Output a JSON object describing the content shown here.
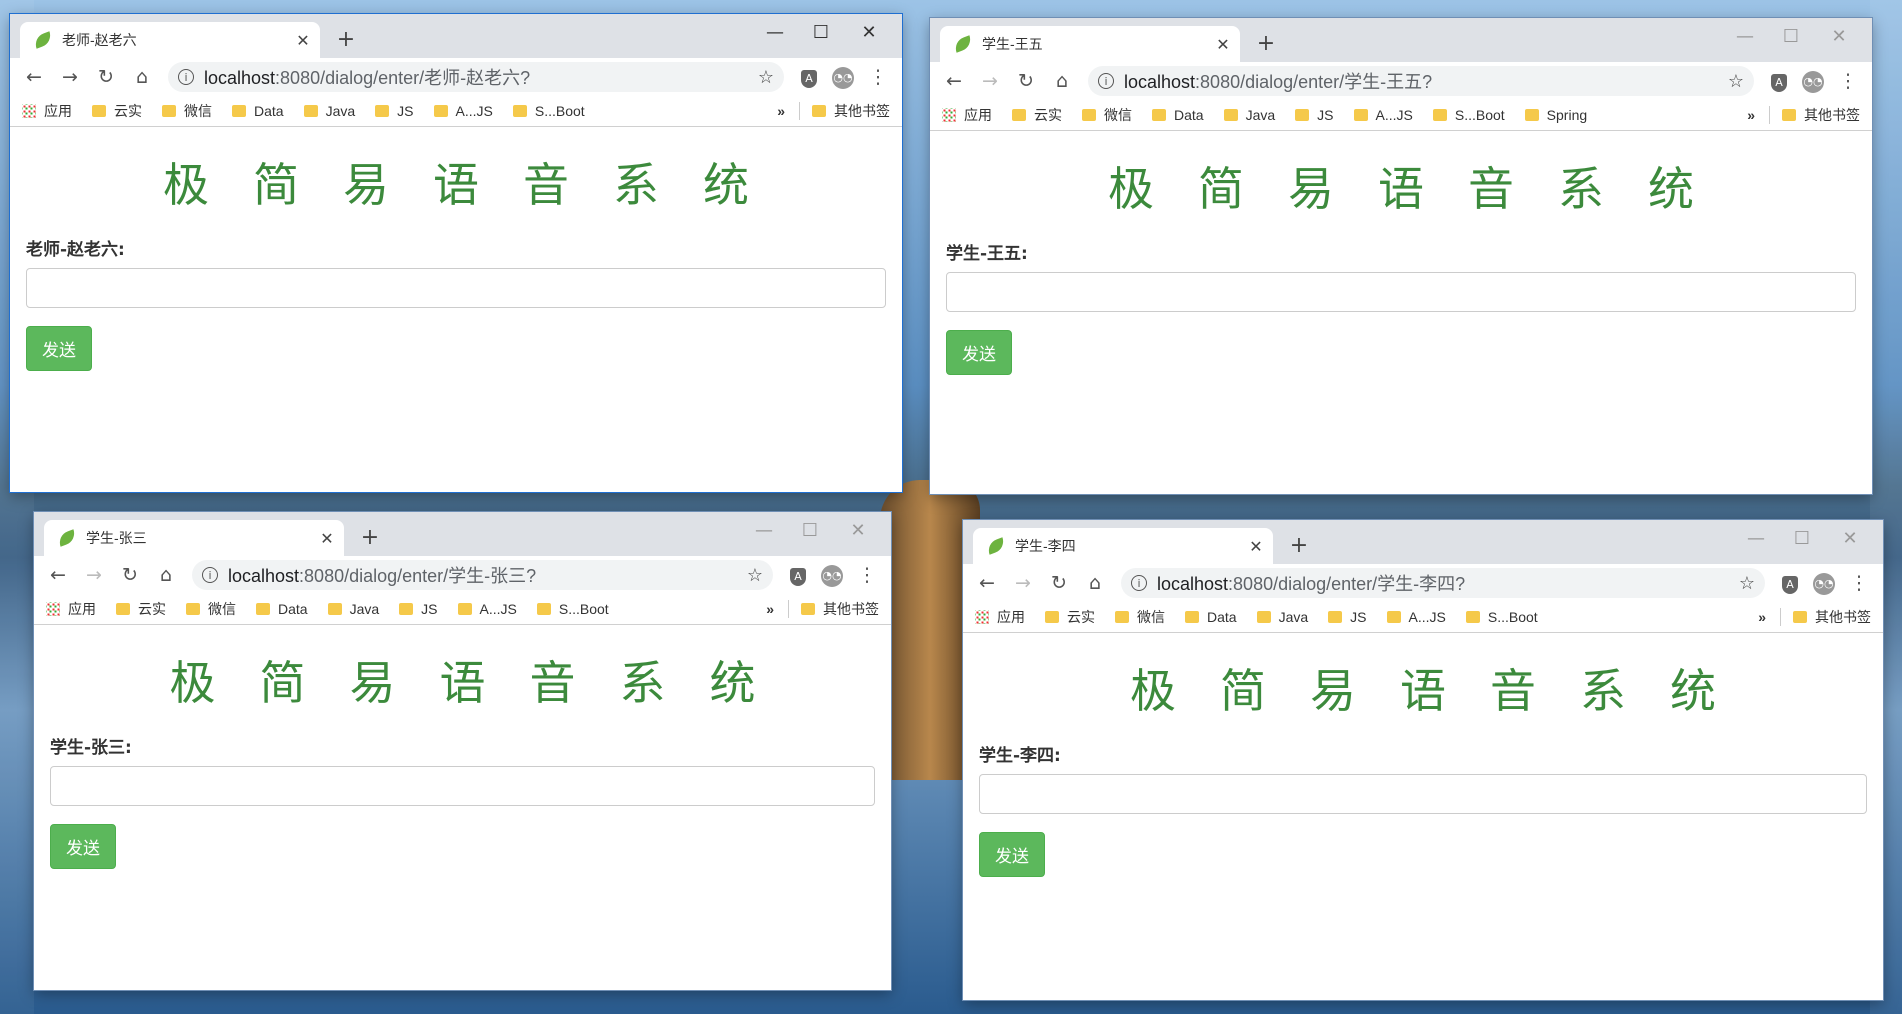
{
  "title": "极简易语音系统",
  "heading_chars": [
    "极",
    "简",
    "易",
    "语",
    "音",
    "系",
    "统"
  ],
  "send_label": "发送",
  "new_tab": "+",
  "tab_close": "✕",
  "window_controls": {
    "minimize": "—",
    "maximize": "☐",
    "close": "✕"
  },
  "nav": {
    "back": "←",
    "forward": "→",
    "reload": "↻",
    "home": "⌂",
    "star": "☆",
    "menu": "⋮",
    "info": "i",
    "ext_label": "A"
  },
  "url_host": "localhost",
  "url_prefix": ":8080/dialog/enter/",
  "bookmarks_more": "»",
  "bookmarks_other": "其他书签",
  "bookmarks_apps": "应用",
  "windows": [
    {
      "tab_title": "老师-赵老六",
      "url_path": "老师-赵老六?",
      "user_label": "老师-赵老六:",
      "active": true,
      "bookmarks": [
        "云实",
        "微信",
        "Data",
        "Java",
        "JS",
        "A...JS",
        "S...Boot"
      ]
    },
    {
      "tab_title": "学生-王五",
      "url_path": "学生-王五?",
      "user_label": "学生-王五:",
      "active": false,
      "bookmarks": [
        "云实",
        "微信",
        "Data",
        "Java",
        "JS",
        "A...JS",
        "S...Boot",
        "Spring"
      ]
    },
    {
      "tab_title": "学生-张三",
      "url_path": "学生-张三?",
      "user_label": "学生-张三:",
      "active": false,
      "bookmarks": [
        "云实",
        "微信",
        "Data",
        "Java",
        "JS",
        "A...JS",
        "S...Boot"
      ]
    },
    {
      "tab_title": "学生-李四",
      "url_path": "学生-李四?",
      "user_label": "学生-李四:",
      "active": false,
      "bookmarks": [
        "云实",
        "微信",
        "Data",
        "Java",
        "JS",
        "A...JS",
        "S...Boot"
      ]
    }
  ]
}
